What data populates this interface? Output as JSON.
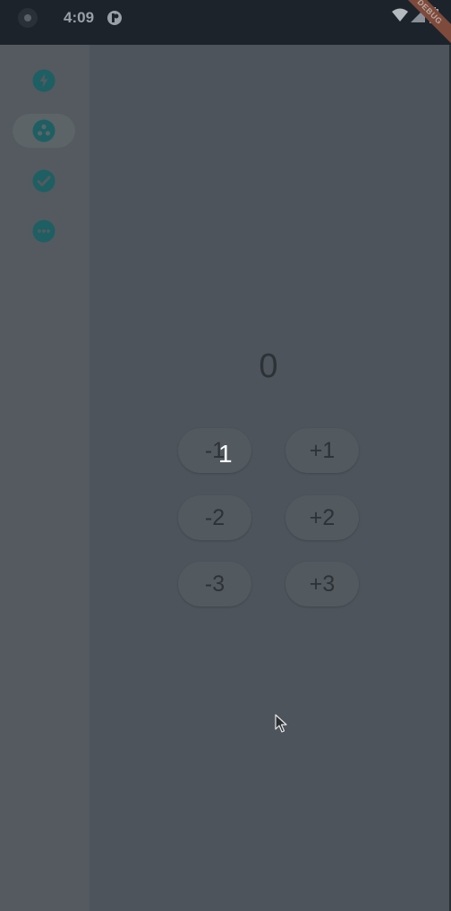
{
  "status_bar": {
    "time": "4:09",
    "banner": "DEBUG",
    "icons": [
      "camera-dot-icon",
      "notification-icon",
      "wifi-icon",
      "signal-icon",
      "battery-icon"
    ]
  },
  "nav_rail": {
    "items": [
      {
        "icon": "bolt-icon",
        "selected": false
      },
      {
        "icon": "bubbles-icon",
        "selected": true
      },
      {
        "icon": "check-circle-icon",
        "selected": false
      },
      {
        "icon": "more-horizontal-icon",
        "selected": false
      }
    ],
    "accent_color": "#1e5f63"
  },
  "counter": {
    "value": "0",
    "overlay_text": "1",
    "buttons": [
      {
        "label": "-1"
      },
      {
        "label": "+1"
      },
      {
        "label": "-2"
      },
      {
        "label": "+2"
      },
      {
        "label": "-3"
      },
      {
        "label": "+3"
      }
    ]
  }
}
